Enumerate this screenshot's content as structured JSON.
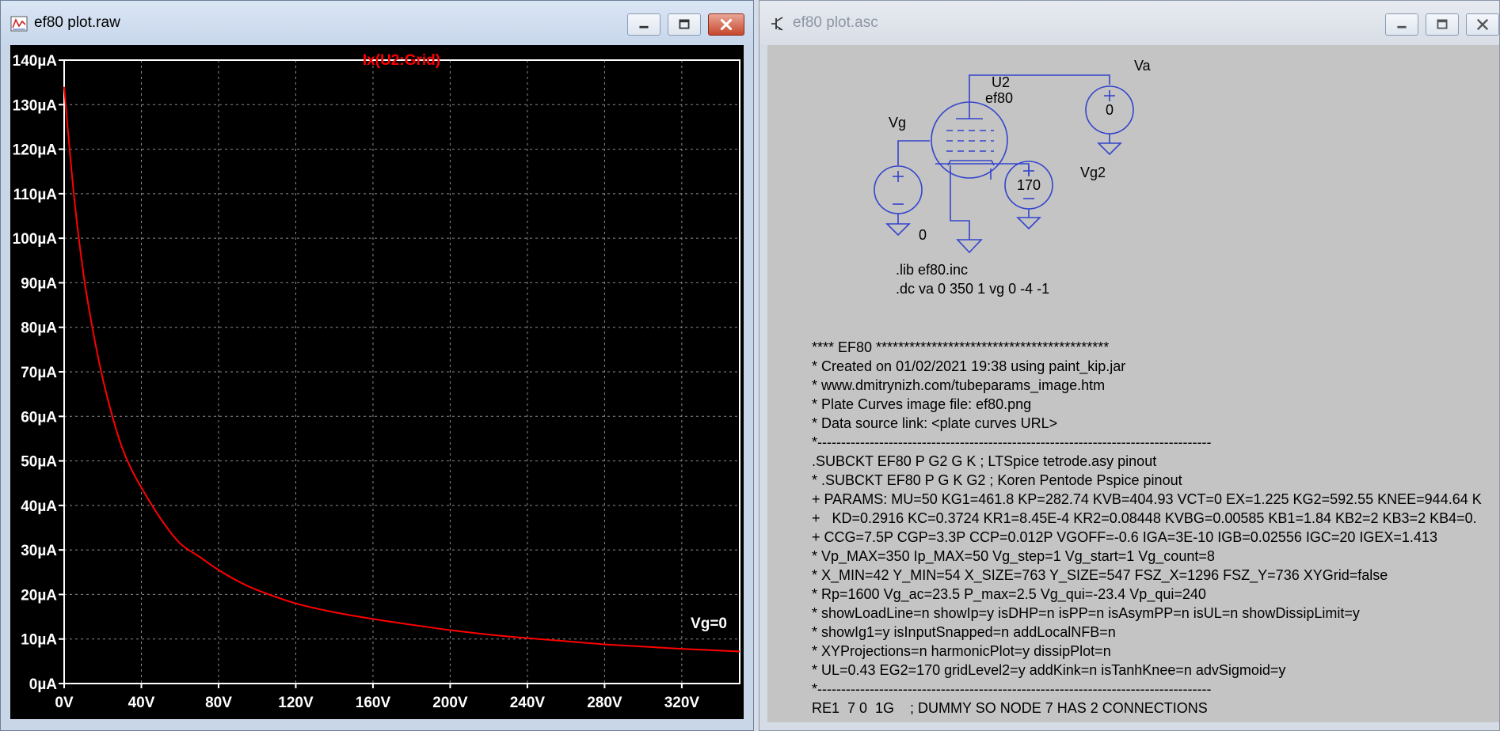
{
  "plot_window": {
    "title": "ef80 plot.raw",
    "trace_label": "Ix(U2:Grid)",
    "annotation": "Vg=0"
  },
  "asc_window": {
    "title": "ef80 plot.asc",
    "schematic": {
      "tube_ref": "U2",
      "tube_model": "ef80",
      "source_va": "Va",
      "source_va_value": "0",
      "source_vg": "Vg",
      "source_vg_value": "0",
      "source_vg2": "Vg2",
      "source_vg2_value": "170",
      "directive_lib": ".lib ef80.inc",
      "directive_dc": ".dc va 0 350 1 vg 0 -4 -1"
    },
    "netlist_lines": [
      "**** EF80 ******************************************",
      "* Created on 01/02/2021 19:38 using paint_kip.jar",
      "* www.dmitrynizh.com/tubeparams_image.htm",
      "* Plate Curves image file: ef80.png",
      "* Data source link: <plate curves URL>",
      "*-----------------------------------------------------------------------------------",
      ".SUBCKT EF80 P G2 G K ; LTSpice tetrode.asy pinout",
      "* .SUBCKT EF80 P G K G2 ; Koren Pentode Pspice pinout",
      "+ PARAMS: MU=50 KG1=461.8 KP=282.74 KVB=404.93 VCT=0 EX=1.225 KG2=592.55 KNEE=944.64 K",
      "+   KD=0.2916 KC=0.3724 KR1=8.45E-4 KR2=0.08448 KVBG=0.00585 KB1=1.84 KB2=2 KB3=2 KB4=0.",
      "+ CCG=7.5P CGP=3.3P CCP=0.012P VGOFF=-0.6 IGA=3E-10 IGB=0.02556 IGC=20 IGEX=1.413",
      "* Vp_MAX=350 Ip_MAX=50 Vg_step=1 Vg_start=1 Vg_count=8",
      "* X_MIN=42 Y_MIN=54 X_SIZE=763 Y_SIZE=547 FSZ_X=1296 FSZ_Y=736 XYGrid=false",
      "* Rp=1600 Vg_ac=23.5 P_max=2.5 Vg_qui=-23.4 Vp_qui=240",
      "* showLoadLine=n showIp=y isDHP=n isPP=n isAsymPP=n isUL=n showDissipLimit=y",
      "* showIg1=y isInputSnapped=n addLocalNFB=n",
      "* XYProjections=n harmonicPlot=y dissipPlot=n",
      "* UL=0.43 EG2=170 gridLevel2=y addKink=n isTanhKnee=n advSigmoid=y",
      "*-----------------------------------------------------------------------------------",
      "RE1  7 0  1G    ; DUMMY SO NODE 7 HAS 2 CONNECTIONS"
    ]
  },
  "colors": {
    "plot_background": "#000000",
    "trace": "#ff0000",
    "grid": "#8c8c8c",
    "schematic_wire": "#3344cc",
    "schematic_background": "#c4c4c4"
  },
  "chart_data": {
    "type": "line",
    "title": "Ix(U2:Grid)",
    "xlabel": "",
    "ylabel": "",
    "xlim": [
      0,
      350
    ],
    "ylim": [
      0,
      140
    ],
    "x_ticks": [
      0,
      40,
      80,
      120,
      160,
      200,
      240,
      280,
      320
    ],
    "x_tick_labels": [
      "0V",
      "40V",
      "80V",
      "120V",
      "160V",
      "200V",
      "240V",
      "280V",
      "320V"
    ],
    "y_ticks": [
      0,
      10,
      20,
      30,
      40,
      50,
      60,
      70,
      80,
      90,
      100,
      110,
      120,
      130,
      140
    ],
    "y_tick_labels": [
      "0µA",
      "10µA",
      "20µA",
      "30µA",
      "40µA",
      "50µA",
      "60µA",
      "70µA",
      "80µA",
      "90µA",
      "100µA",
      "110µA",
      "120µA",
      "130µA",
      "140µA"
    ],
    "grid": true,
    "series": [
      {
        "name": "Ix(U2:Grid)",
        "x": [
          0,
          5,
          10,
          15,
          20,
          25,
          30,
          35,
          40,
          50,
          60,
          70,
          80,
          90,
          100,
          120,
          140,
          160,
          180,
          200,
          220,
          240,
          260,
          280,
          300,
          320,
          350
        ],
        "y": [
          134,
          110,
          92,
          79,
          68.5,
          60,
          53,
          48,
          44,
          37,
          31.5,
          28.5,
          25.5,
          23,
          21,
          18,
          16,
          14.5,
          13.2,
          12,
          11,
          10.2,
          9.5,
          8.8,
          8.3,
          7.8,
          7.2
        ]
      }
    ],
    "annotations": [
      "Vg=0"
    ]
  }
}
